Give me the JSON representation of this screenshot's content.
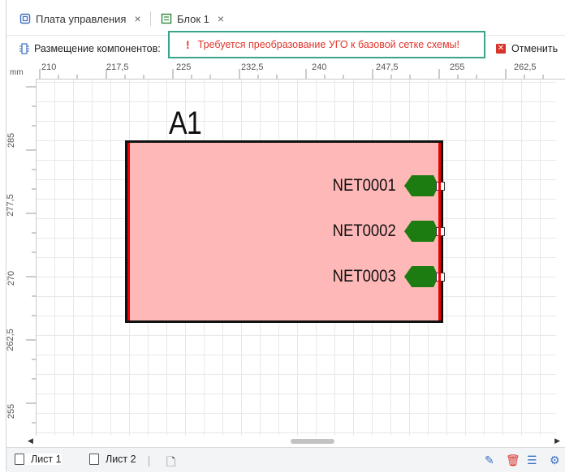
{
  "tabs": [
    {
      "label": "Плата управления",
      "icon": "board-icon",
      "close": "×"
    },
    {
      "label": "Блок 1",
      "icon": "block-icon",
      "close": "×"
    }
  ],
  "toolbar": {
    "placement_label": "Размещение компонентов:",
    "warning_mark": "!",
    "warning_text": "Требуется преобразование УГО к базовой сетке схемы!",
    "cancel_label": "Отменить"
  },
  "ruler": {
    "unit": "mm",
    "top_ticks": [
      "210",
      "217,5",
      "225",
      "232,5",
      "240",
      "247,5",
      "255",
      "262,5"
    ],
    "left_ticks": [
      "285",
      "277,5",
      "270",
      "262,5",
      "255"
    ]
  },
  "component": {
    "ref": "A1",
    "fill": "#ffb8b8",
    "pins": [
      "NET0001",
      "NET0002",
      "NET0003"
    ],
    "port_color": "#1c7c12"
  },
  "sheets": [
    {
      "label": "Лист 1"
    },
    {
      "label": "Лист 2"
    }
  ],
  "colors": {
    "warning": "#e0342b",
    "warning_border": "#3aa58a",
    "cancel_icon": "#d8322b"
  }
}
